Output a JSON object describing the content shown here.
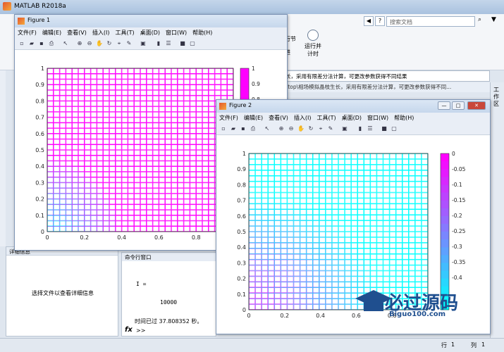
{
  "app": {
    "title": "MATLAB R2018a",
    "search_placeholder": "搜索文档"
  },
  "ribbon": {
    "btn1": "行节",
    "btn1b": "进",
    "btn2": "运行并",
    "btn2b": "计时"
  },
  "address": {
    "line1": "长，采用有限差分法计算，可更改参数获得不同结果",
    "line2": "ktop\\相场模拟晶枝生长，采用有限差分法计算，可更改参数获得不同..."
  },
  "workspace_tab": "工作区",
  "detail": {
    "header": "详细信息",
    "message": "选择文件以查看详细信息"
  },
  "cmd": {
    "header": "命令行窗口",
    "var_name": "I =",
    "var_value": "10000",
    "elapsed": "时间已过 37.808352 秒。",
    "prompt": ">>",
    "fx": "fx"
  },
  "status": {
    "row_label": "行",
    "row": "1",
    "col_label": "列",
    "col": "1"
  },
  "menu": [
    "文件(F)",
    "编辑(E)",
    "查看(V)",
    "插入(I)",
    "工具(T)",
    "桌面(D)",
    "窗口(W)",
    "帮助(H)"
  ],
  "figure1": {
    "title": "Figure 1",
    "xticks": [
      "0",
      "0.2",
      "0.4",
      "0.6",
      "0.8"
    ],
    "yticks": [
      "0",
      "0.1",
      "0.2",
      "0.3",
      "0.4",
      "0.5",
      "0.6",
      "0.7",
      "0.8",
      "0.9",
      "1"
    ],
    "cbar_ticks": [
      "1",
      "0.9",
      "0.8"
    ]
  },
  "figure2": {
    "title": "Figure 2",
    "xticks": [
      "0",
      "0.2",
      "0.4",
      "0.6",
      "0.8"
    ],
    "yticks": [
      "0",
      "0.1",
      "0.2",
      "0.3",
      "0.4",
      "0.5",
      "0.6",
      "0.7",
      "0.8",
      "0.9",
      "1"
    ],
    "cbar_ticks": [
      "0",
      "-0.05",
      "-0.1",
      "-0.15",
      "-0.2",
      "-0.25",
      "-0.3",
      "-0.35",
      "-0.4"
    ]
  },
  "watermark": {
    "text": "必过源码",
    "url": "Biguo100.com"
  },
  "colors": {
    "magenta": "#ff00ff",
    "cyan": "#00ffff",
    "accent": "#1f4f8f"
  }
}
